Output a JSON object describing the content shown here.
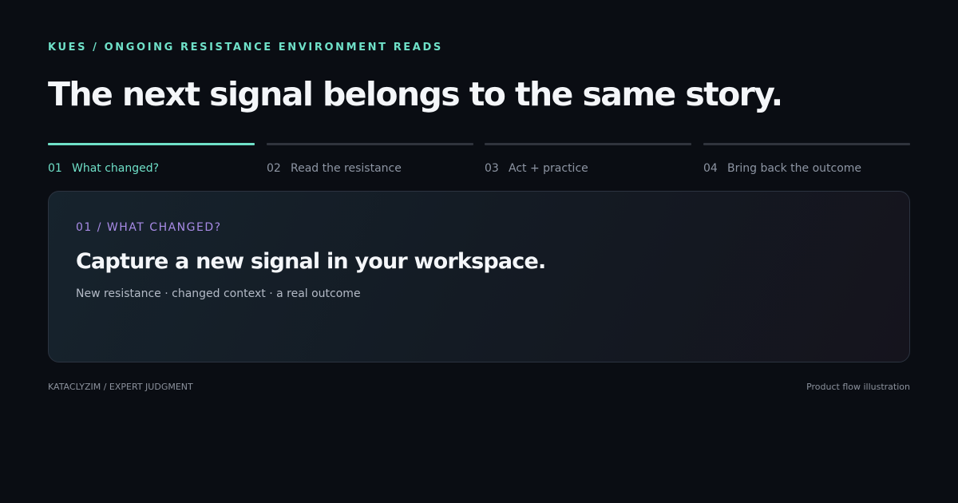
{
  "header": {
    "eyebrow": "KUES / ONGOING RESISTANCE ENVIRONMENT READS",
    "headline": "The next signal belongs to the same story."
  },
  "steps": [
    {
      "number": "01",
      "label": "What changed?",
      "active": true
    },
    {
      "number": "02",
      "label": "Read the resistance",
      "active": false
    },
    {
      "number": "03",
      "label": "Act + practice",
      "active": false
    },
    {
      "number": "04",
      "label": "Bring back the outcome",
      "active": false
    }
  ],
  "card": {
    "kicker": "01 / WHAT CHANGED?",
    "title": "Capture a new signal in your workspace.",
    "subtitle": "New resistance · changed context · a real outcome"
  },
  "footer": {
    "left": "KATACLYZIM / EXPERT JUDGMENT",
    "right": "Product flow illustration"
  },
  "colors": {
    "background": "#0a0d13",
    "accent": "#6fe0c8",
    "kicker": "#a88be6",
    "muted": "#8d95a3"
  }
}
